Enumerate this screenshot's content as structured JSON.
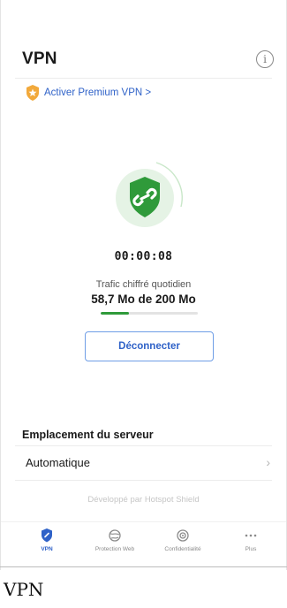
{
  "header": {
    "title": "VPN"
  },
  "premium": {
    "label": "Activer Premium VPN >",
    "accent": "#2f62c8",
    "badge_color": "#f2a93b"
  },
  "status": {
    "timer": "00:00:08",
    "shield_color": "#2f9a3a"
  },
  "traffic": {
    "label": "Trafic chiffré quotidien",
    "value": "58,7 Mo de 200 Mo",
    "progress_fraction": 0.29
  },
  "actions": {
    "disconnect_label": "Déconnecter"
  },
  "server": {
    "section_title": "Emplacement du serveur",
    "location": "Automatique"
  },
  "footer": {
    "developer_text": "Développé par Hotspot Shield"
  },
  "tabs": [
    {
      "label": "VPN",
      "icon": "vpn-shield-icon",
      "active": true
    },
    {
      "label": "Protection Web",
      "icon": "globe-shield-icon",
      "active": false
    },
    {
      "label": "Confidentialité",
      "icon": "eye-icon",
      "active": false
    },
    {
      "label": "Plus",
      "icon": "more-dots-icon",
      "active": false
    }
  ],
  "caption": "VPN"
}
